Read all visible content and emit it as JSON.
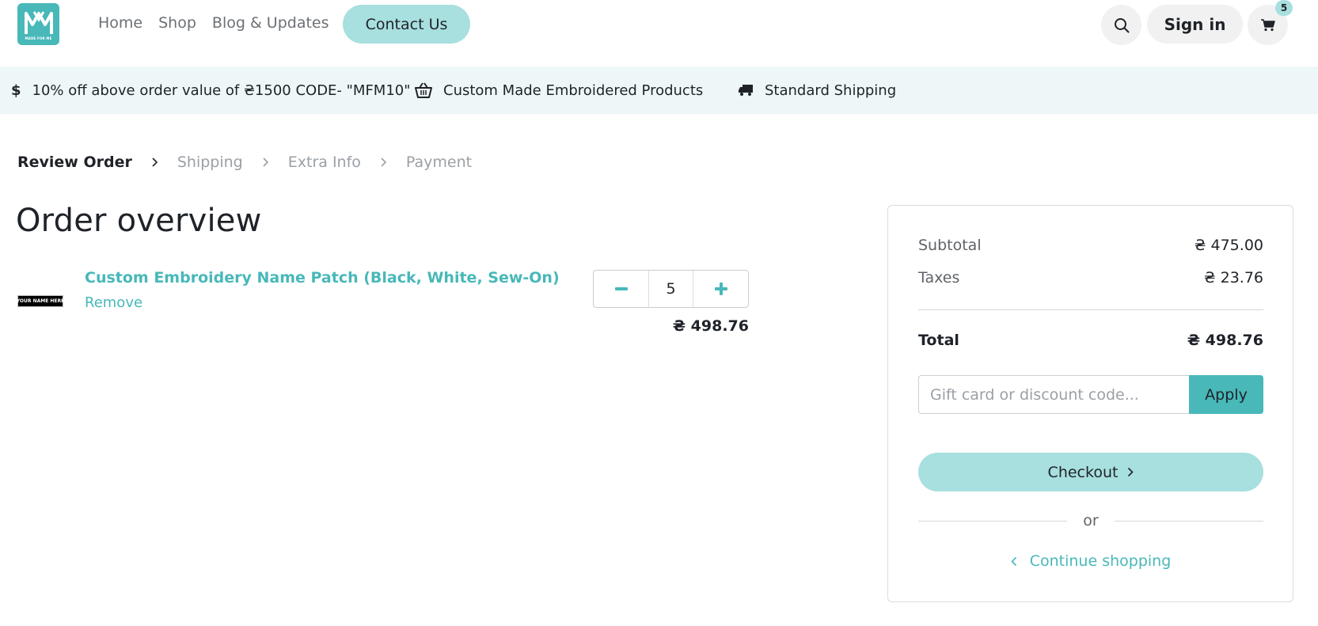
{
  "header": {
    "logo_text": "MADE FOR ME",
    "nav": [
      "Home",
      "Shop",
      "Blog & Updates"
    ],
    "contact_label": "Contact Us",
    "signin_label": "Sign in",
    "cart_count": "5"
  },
  "banner": {
    "promo_text": "10% off above order value of ₴1500  CODE- \"MFM10\"",
    "products_text": "Custom Made Embroidered Products",
    "shipping_text": "Standard Shipping"
  },
  "steps": [
    "Review Order",
    "Shipping",
    "Extra Info",
    "Payment"
  ],
  "page_title": "Order overview",
  "item": {
    "image_text": "YOUR NAME HERE",
    "name": "Custom Embroidery Name Patch (Black, White, Sew-On)",
    "remove_label": "Remove",
    "quantity": "5",
    "price": "₴ 498.76"
  },
  "summary": {
    "subtotal_label": "Subtotal",
    "subtotal_value": "₴ 475.00",
    "taxes_label": "Taxes",
    "taxes_value": "₴ 23.76",
    "total_label": "Total",
    "total_value": "₴ 498.76",
    "promo_placeholder": "Gift card or discount code...",
    "apply_label": "Apply",
    "checkout_label": "Checkout",
    "or_label": "or",
    "continue_label": "Continue shopping"
  },
  "colors": {
    "accent": "#48b8b9",
    "accent_light": "#a8dfdf",
    "banner_bg": "#edf7f7"
  }
}
